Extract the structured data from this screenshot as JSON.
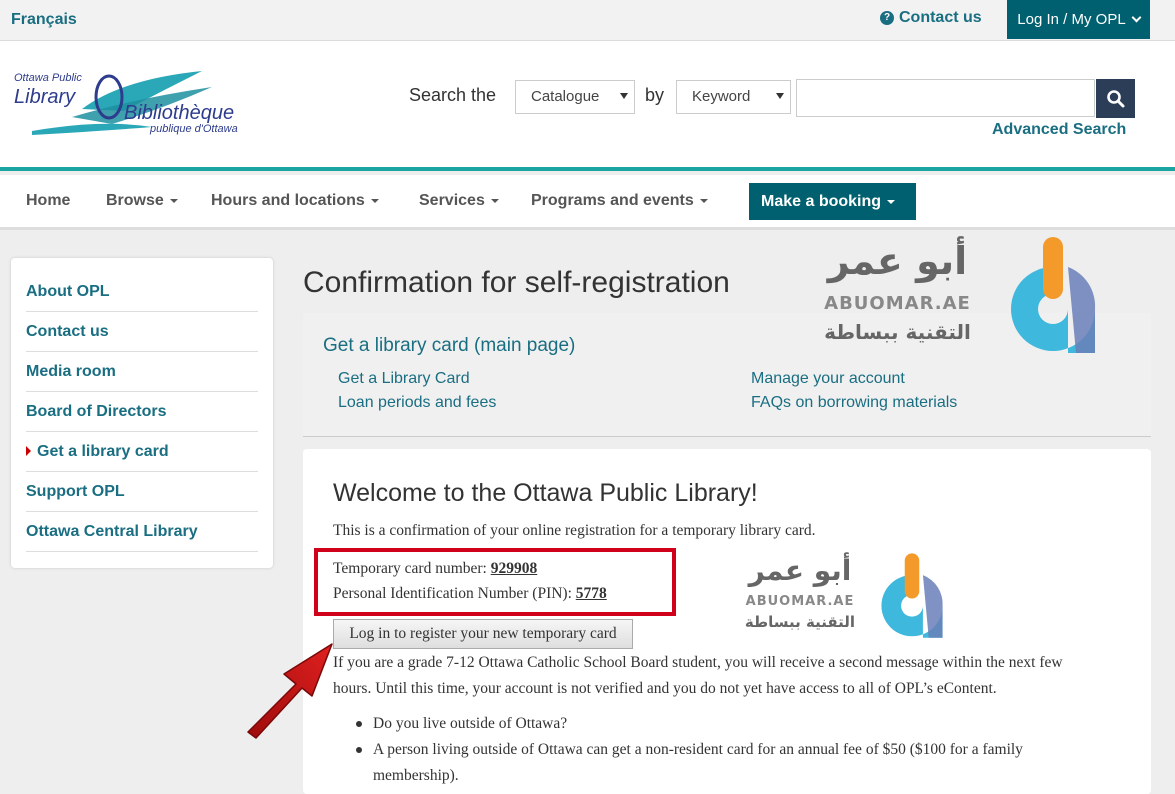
{
  "topbar": {
    "language": "Français",
    "contact": "Contact us",
    "login": "Log In / My OPL"
  },
  "header": {
    "logo": {
      "line1": "Ottawa Public",
      "line2": "Library",
      "line3": "Bibliothèque",
      "line4": "publique d'Ottawa"
    },
    "search_label": "Search the",
    "search_scope": "Catalogue",
    "by_label": "by",
    "search_by": "Keyword",
    "search_value": "",
    "advanced_search": "Advanced Search"
  },
  "nav": {
    "items": [
      {
        "label": "Home"
      },
      {
        "label": "Browse"
      },
      {
        "label": "Hours and locations"
      },
      {
        "label": "Services"
      },
      {
        "label": "Programs and events"
      }
    ],
    "booking": "Make a booking"
  },
  "sidebar": {
    "items": [
      {
        "label": "About OPL"
      },
      {
        "label": "Contact us"
      },
      {
        "label": "Media room"
      },
      {
        "label": "Board of Directors"
      },
      {
        "label": "Get a library card",
        "active": true
      },
      {
        "label": "Support OPL"
      },
      {
        "label": "Ottawa Central Library"
      }
    ]
  },
  "main": {
    "title": "Confirmation for self-registration",
    "subnav": {
      "main_link": "Get a library card (main page)",
      "links": [
        "Get a Library Card",
        "Loan periods and fees",
        "Manage your account",
        "FAQs on borrowing materials"
      ]
    },
    "card": {
      "title": "Welcome to the Ottawa Public Library!",
      "confirm_text": "This is a confirmation of your online registration for a temporary library card.",
      "card_number_label": "Temporary card number: ",
      "card_number": "929908",
      "pin_label": "Personal Identification Number (PIN): ",
      "pin": "5778",
      "login_button": "Log in to register your new temporary card",
      "paragraph": "If you are a grade 7-12 Ottawa Catholic School Board student, you will receive a second message within the next few hours. Until this time, your account is not verified and you do not yet have access to all of OPL’s eContent.",
      "bullets": [
        "Do you live outside of Ottawa?",
        "A person living outside of Ottawa can get a non-resident card for an annual fee of $50 ($100 for a family membership)."
      ]
    }
  },
  "watermark": {
    "arabic_top": "أبو عمر",
    "latin": "ABUOMAR.AE",
    "arabic_bottom": "التقنية ببساطة"
  },
  "colors": {
    "teal": "#00606f",
    "link": "#1a6e82",
    "accent_line": "#1aa5a0",
    "highlight": "#d0021b"
  }
}
